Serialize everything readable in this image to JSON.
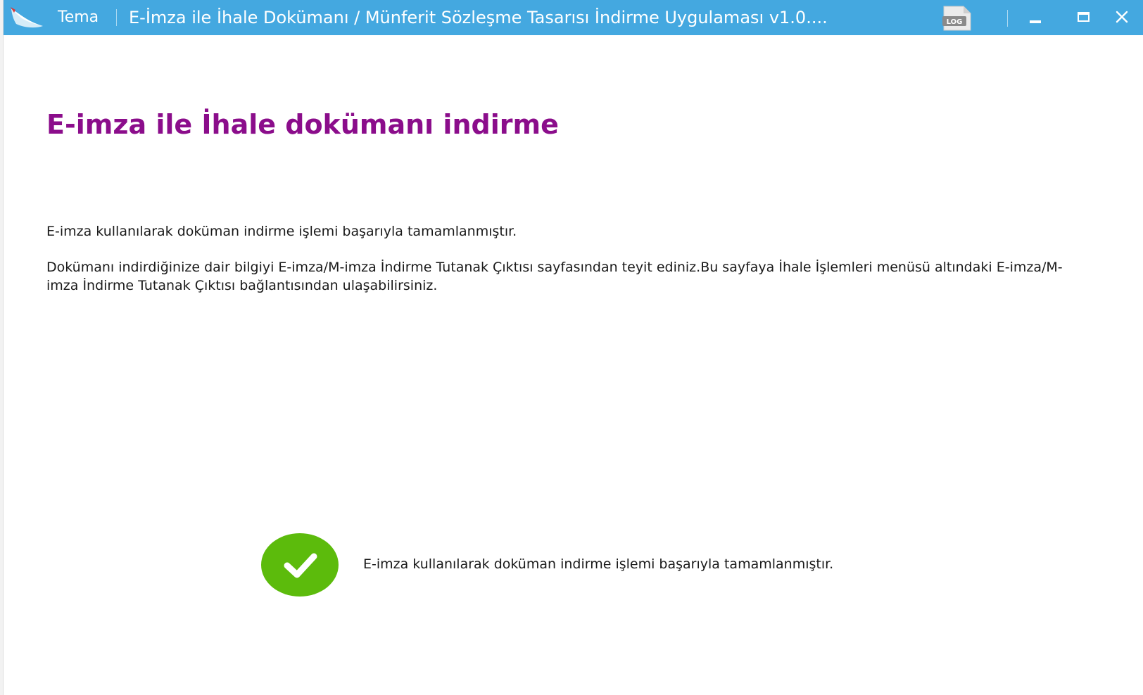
{
  "titlebar": {
    "app_name": "Tema",
    "window_title": "E-İmza ile İhale Dokümanı / Münferit Sözleşme Tasarısı İndirme Uygulaması v1.0....",
    "log_label": "LOG",
    "icons": {
      "logo": "app-logo-icon",
      "log": "log-file-icon",
      "minimize": "minimize-icon",
      "maximize": "maximize-icon",
      "close": "close-icon"
    },
    "colors": {
      "background": "#44a8e0",
      "foreground": "#ffffff"
    }
  },
  "main": {
    "title": "E-imza ile İhale dokümanı indirme",
    "paragraphs": [
      "E-imza kullanılarak doküman indirme işlemi başarıyla tamamlanmıştır.",
      "Dokümanı indirdiğinize dair bilgiyi E-imza/M-imza İndirme Tutanak Çıktısı sayfasından teyit ediniz.Bu sayfaya İhale İşlemleri menüsü altındaki E-imza/M-imza İndirme Tutanak Çıktısı bağlantısından ulaşabilirsiniz."
    ],
    "title_color": "#8b0d8b"
  },
  "status": {
    "icon": "check-circle-icon",
    "color": "#5cbb0c",
    "message": "E-imza kullanılarak doküman indirme işlemi başarıyla tamamlanmıştır."
  }
}
